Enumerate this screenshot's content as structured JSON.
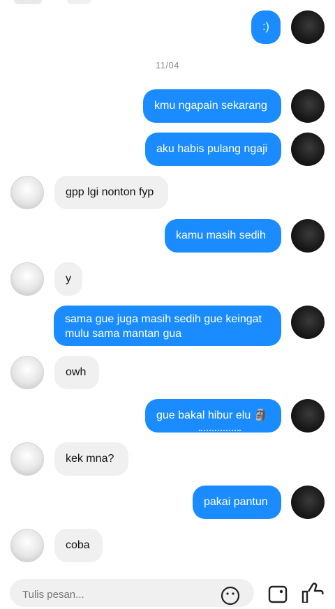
{
  "thread": {
    "date_separator": "11/04",
    "messages": [
      {
        "dir": "out",
        "text": ":)"
      },
      {
        "dir": "out",
        "text": "kmu ngapain sekarang"
      },
      {
        "dir": "out",
        "text": "aku habis pulang ngaji"
      },
      {
        "dir": "in",
        "text": "gpp lgi nonton fyp"
      },
      {
        "dir": "out",
        "text": "kamu masih sedih"
      },
      {
        "dir": "in",
        "text": "y"
      },
      {
        "dir": "out",
        "text": "sama gue juga masih sedih gue keingat mulu sama mantan gua"
      },
      {
        "dir": "in",
        "text": "owh"
      },
      {
        "dir": "out",
        "text": "gue bakal hibur elu 🗿"
      },
      {
        "dir": "in",
        "text": "kek mna?"
      },
      {
        "dir": "out",
        "text": "pakai pantun"
      },
      {
        "dir": "in",
        "text": "coba"
      }
    ]
  },
  "composer": {
    "placeholder": "Tulis pesan..."
  },
  "icons": {
    "emoji": "smiley-icon",
    "image": "image-icon",
    "like": "thumbs-up-icon"
  },
  "colors": {
    "outgoing_bubble": "#1a8cff",
    "incoming_bubble": "#f0f0f0"
  }
}
